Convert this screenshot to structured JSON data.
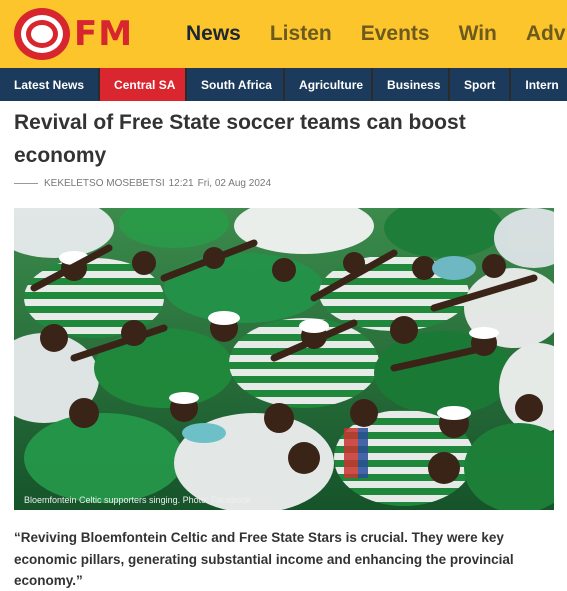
{
  "header": {
    "logo_text": "FM",
    "nav": [
      "News",
      "Listen",
      "Events",
      "Win",
      "Adv"
    ]
  },
  "subnav": [
    "Latest News",
    "Central SA",
    "South Africa",
    "Agriculture",
    "Business",
    "Sport",
    "Intern"
  ],
  "article": {
    "title": "Revival of Free State soccer teams can boost economy",
    "author": "KEKELETSO MOSEBETSI",
    "time": "12:21",
    "date": "Fri, 02 Aug 2024",
    "image_caption": "Bloemfontein Celtic supporters singing. Photo: Facebook",
    "quote": "“Reviving Bloemfontein Celtic and Free State Stars is crucial. They were key economic pillars, generating substantial income and enhancing the provincial economy.”"
  },
  "colors": {
    "header_bg": "#fdc52c",
    "brand_red": "#d8262e",
    "subnav_bg": "#1c3a5c",
    "subnav_active": "#d9262f"
  }
}
